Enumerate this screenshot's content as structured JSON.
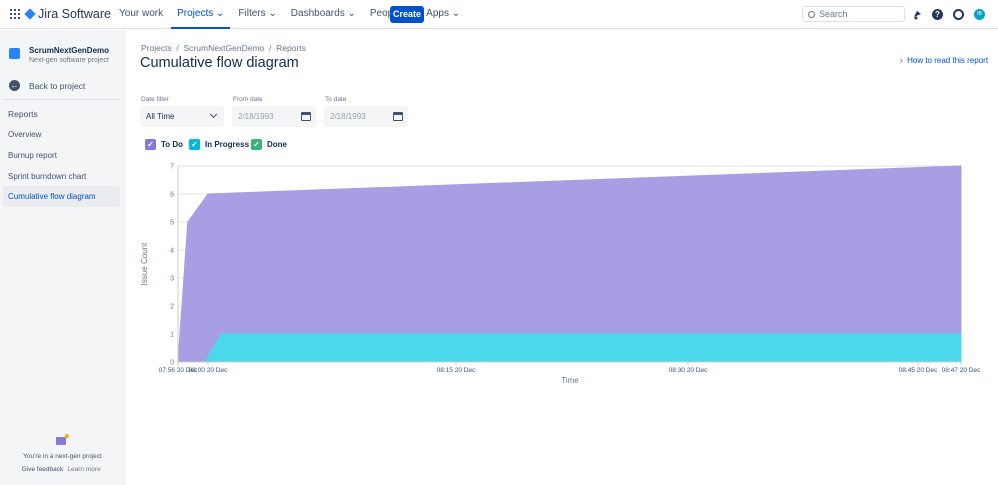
{
  "topnav": {
    "product": "Jira Software",
    "items": [
      {
        "label": "Your work"
      },
      {
        "label": "Projects ⌄"
      },
      {
        "label": "Filters ⌄"
      },
      {
        "label": "Dashboards ⌄"
      },
      {
        "label": "People ⌄"
      },
      {
        "label": "Apps ⌄"
      }
    ],
    "create": "Create",
    "search_placeholder": "Search",
    "avatar_initials": "IB"
  },
  "sidebar": {
    "project_name": "ScrumNextGenDemo",
    "project_type": "Next-gen software project",
    "back": "Back to project",
    "section": "Reports",
    "items": [
      {
        "label": "Overview"
      },
      {
        "label": "Burnup report"
      },
      {
        "label": "Sprint burndown chart"
      },
      {
        "label": "Cumulative flow diagram"
      }
    ],
    "footer_text": "You're in a next-gen project",
    "give_feedback": "Give feedback",
    "learn_more": "Learn more"
  },
  "main": {
    "breadcrumb": "Projects  /  ScrumNextGenDemo  /  Reports",
    "title": "Cumulative flow diagram",
    "how_to": "How to read this report",
    "date_filter_label": "Date filter",
    "date_filter_value": "All Time",
    "from_label": "From date",
    "from_value": "2/18/1993",
    "to_label": "To date",
    "to_value": "2/18/1993"
  },
  "chart_data": {
    "type": "area",
    "stacked": true,
    "xlabel": "Time",
    "ylabel": "Issue Count",
    "ylim": [
      0,
      7
    ],
    "yticks": [
      "0",
      "1",
      "2",
      "3",
      "4",
      "5",
      "6",
      "7"
    ],
    "x_unit": "minutes after 07:56 20 Dec",
    "xticks": [
      {
        "label": "07:56 20 Dec",
        "min": 0
      },
      {
        "label": "08:00 20 Dec",
        "min": 4
      },
      {
        "label": "08:15 20 Dec",
        "min": 19
      },
      {
        "label": "08:30 20 Dec",
        "min": 34
      },
      {
        "label": "08:45 20 Dec",
        "min": 49
      },
      {
        "label": "08:47 20 Dec",
        "min": 51
      }
    ],
    "series": [
      {
        "name": "Done",
        "color": "#36b37e",
        "points": [
          [
            0,
            0
          ],
          [
            51,
            0
          ]
        ]
      },
      {
        "name": "In Progress",
        "color": "#4bd8eb",
        "points": [
          [
            0,
            0
          ],
          [
            3.6,
            0
          ],
          [
            4.8,
            1
          ],
          [
            51,
            1
          ]
        ]
      },
      {
        "name": "To Do",
        "color": "#a89ee4",
        "points": [
          [
            0,
            0
          ],
          [
            1.3,
            5
          ],
          [
            4,
            6
          ],
          [
            51,
            7
          ]
        ]
      }
    ],
    "legend": [
      {
        "name": "To Do",
        "color": "#8777d9"
      },
      {
        "name": "In Progress",
        "color": "#00b8d9"
      },
      {
        "name": "Done",
        "color": "#36b37e"
      }
    ]
  }
}
